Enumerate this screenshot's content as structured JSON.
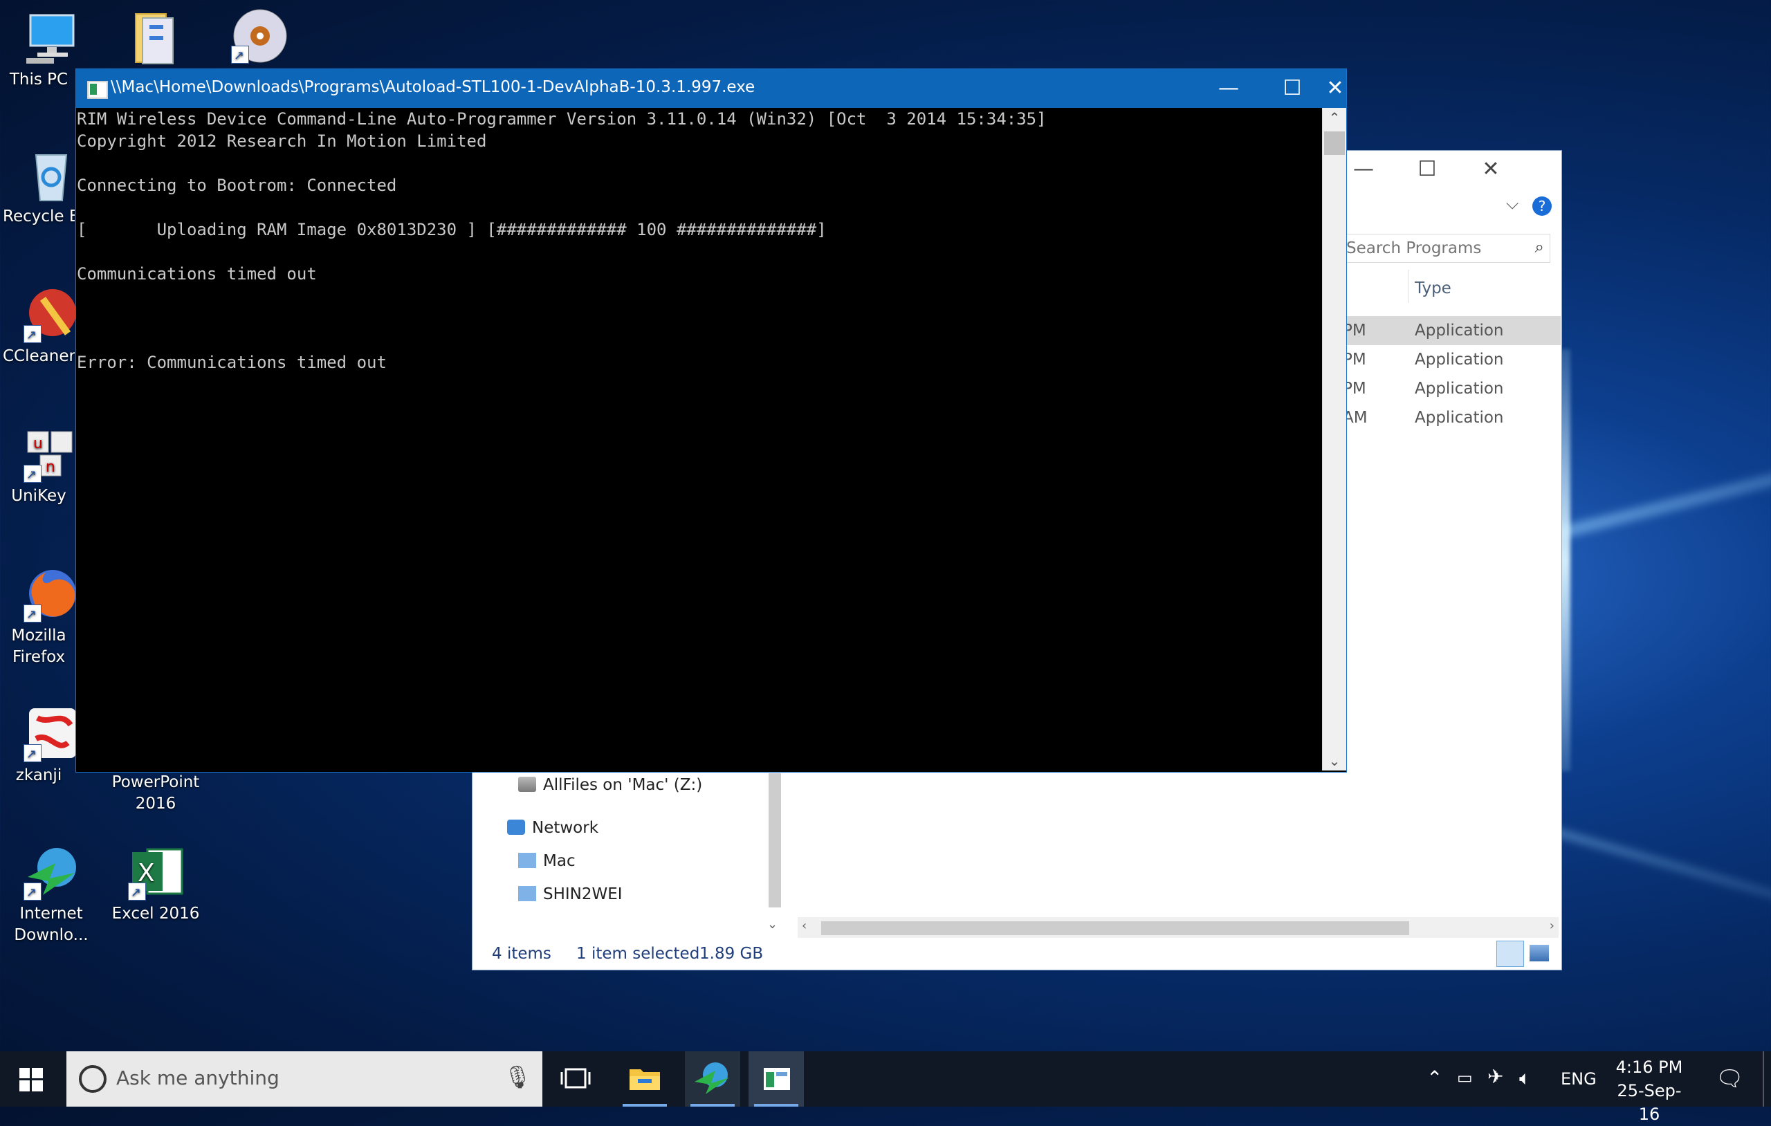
{
  "desktop": {
    "icons": [
      {
        "label": "This PC"
      },
      {
        "label": "Recycle Bin"
      },
      {
        "label": "CCleaner"
      },
      {
        "label": "UniKey"
      },
      {
        "label": "Mozilla Firefox"
      },
      {
        "label": "zkanji"
      },
      {
        "label": "PowerPoint 2016"
      },
      {
        "label": "Internet Downlo..."
      },
      {
        "label": "Excel 2016"
      }
    ]
  },
  "explorer": {
    "search_placeholder": "Search Programs",
    "column_type": "Type",
    "rows": [
      {
        "time": "PM",
        "type": "Application"
      },
      {
        "time": "PM",
        "type": "Application"
      },
      {
        "time": "PM",
        "type": "Application"
      },
      {
        "time": "AM",
        "type": "Application"
      }
    ],
    "nav": {
      "drive": "AllFiles on 'Mac' (Z:)",
      "network": "Network",
      "mac": "Mac",
      "shin": "SHIN2WEI"
    },
    "status": {
      "items": "4 items",
      "selected": "1 item selected",
      "size": "1.89 GB"
    }
  },
  "console": {
    "title": "\\\\Mac\\Home\\Downloads\\Programs\\Autoload-STL100-1-DevAlphaB-10.3.1.997.exe",
    "lines": [
      "RIM Wireless Device Command-Line Auto-Programmer Version 3.11.0.14 (Win32) [Oct  3 2014 15:34:35]",
      "Copyright 2012 Research In Motion Limited",
      "",
      "Connecting to Bootrom: Connected",
      "",
      "[       Uploading RAM Image 0x8013D230 ] [############# 100 ##############]",
      "",
      "Communications timed out",
      "",
      "",
      "",
      "Error: Communications timed out"
    ]
  },
  "taskbar": {
    "search_placeholder": "Ask me anything",
    "lang": "ENG",
    "time": "4:16 PM",
    "date": "25-Sep-16"
  }
}
